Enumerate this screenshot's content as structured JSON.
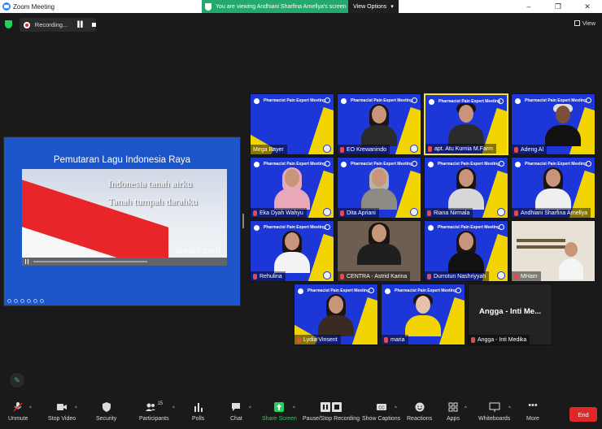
{
  "window": {
    "title": "Zoom Meeting"
  },
  "banner": {
    "text": "You are viewing Andhiani Sharfina Arnellya's screen",
    "options_label": "View Options"
  },
  "status": {
    "recording_label": "Recording...",
    "view_label": "View"
  },
  "shared_screen": {
    "slide_title": "Pemutaran Lagu Indonesia Raya",
    "lyric_line1": "Indonesia tanah airku",
    "lyric_line2": "Tanah tumpah darahku",
    "watermark": "dream.com"
  },
  "meeting_banner": "Pharmacist Pain Expert Meeting",
  "participants": [
    {
      "name": "Mega Bayer",
      "muted": false
    },
    {
      "name": "EO Krewanindo",
      "muted": true
    },
    {
      "name": "apt. Atu Kurnia M.Farm",
      "muted": true
    },
    {
      "name": "Adeng Al",
      "muted": true
    },
    {
      "name": "Eka Dyah Wahyu",
      "muted": true
    },
    {
      "name": "Dita Apriani",
      "muted": true
    },
    {
      "name": "Riana Nirmala",
      "muted": true
    },
    {
      "name": "Andhiani Sharfina Arnellya",
      "muted": true
    },
    {
      "name": "Rehulina",
      "muted": true
    },
    {
      "name": "CENTRA - Astrid Karina",
      "muted": true
    },
    {
      "name": "Durrotun Nashriyyah",
      "muted": true
    },
    {
      "name": "MHam",
      "muted": true
    },
    {
      "name": "Lydia Vinsent",
      "muted": true
    },
    {
      "name": "maria",
      "muted": true
    },
    {
      "name": "Angga - Inti Medika",
      "muted": true,
      "display": "Angga - Inti Me..."
    }
  ],
  "toolbar": {
    "unmute": "Unmute",
    "stop_video": "Stop Video",
    "security": "Security",
    "participants": "Participants",
    "participants_count": "15",
    "polls": "Polls",
    "chat": "Chat",
    "share_screen": "Share Screen",
    "pause_recording": "Pause/Stop Recording",
    "show_captions": "Show Captions",
    "reactions": "Reactions",
    "apps": "Apps",
    "whiteboards": "Whiteboards",
    "more": "More",
    "end": "End"
  },
  "colors": {
    "accent": "#23d160",
    "tile_blue": "#1c36d8",
    "tile_yellow": "#f2d400",
    "end_red": "#e02828"
  }
}
